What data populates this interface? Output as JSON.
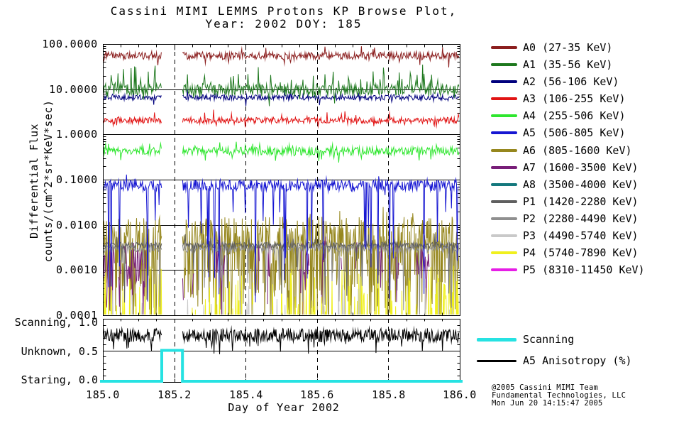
{
  "title": {
    "line1": "Cassini MIMI LEMMS Protons KP Browse Plot,",
    "line2": "Year: 2002 DOY: 185"
  },
  "chart_data": {
    "type": "line",
    "title": "Cassini MIMI LEMMS Protons KP Browse Plot, Year: 2002 DOY: 185",
    "x_axis": {
      "label": "Day of Year 2002",
      "lim": [
        185.0,
        186.0
      ],
      "tick_labels": [
        "185.0",
        "185.2",
        "185.4",
        "185.6",
        "185.8",
        "186.0"
      ],
      "minor_step": 0.05,
      "dashed_gridlines": [
        185.2,
        185.4,
        185.6,
        185.8
      ]
    },
    "y_axis": {
      "label_line1": "Differential Flux",
      "label_line2": "counts/(cm^2*sr*KeV*sec)",
      "scale": "log",
      "log_lim": [
        -4,
        2
      ],
      "tick_labels": [
        "100.0000",
        "10.0000",
        "1.0000",
        "0.1000",
        "0.0100",
        "0.0010",
        "0.0001"
      ]
    },
    "data_gap_x": [
      185.165,
      185.223
    ],
    "series": [
      {
        "name": "A0",
        "label": "A0 (27-35 KeV)",
        "color": "#8b1e1e",
        "visible": true,
        "z": 12,
        "points": 520,
        "typical_flux": 55,
        "log_mean": 1.74,
        "log_jitter": 0.08,
        "spike_up_prob": 0.05,
        "spike_up_max": 0.18,
        "spike_down_prob": 0.05,
        "spike_down_max": 0.22
      },
      {
        "name": "A1",
        "label": "A1 (35-56 KeV)",
        "color": "#1e781e",
        "visible": true,
        "z": 11,
        "points": 520,
        "typical_flux": 10,
        "log_mean": 0.99,
        "log_jitter": 0.13,
        "spike_up_prob": 0.14,
        "spike_up_max": 0.5,
        "spike_down_prob": 0.05,
        "spike_down_max": 0.25
      },
      {
        "name": "A2",
        "label": "A2 (56-106 KeV)",
        "color": "#00007d",
        "visible": true,
        "z": 10,
        "points": 520,
        "typical_flux": 6.6,
        "log_mean": 0.82,
        "log_jitter": 0.06,
        "spike_up_prob": 0.04,
        "spike_up_max": 0.12,
        "spike_down_prob": 0.04,
        "spike_down_max": 0.15
      },
      {
        "name": "A3",
        "label": "A3 (106-255 KeV)",
        "color": "#e11414",
        "visible": true,
        "z": 9,
        "points": 520,
        "typical_flux": 2.0,
        "log_mean": 0.31,
        "log_jitter": 0.07,
        "spike_up_prob": 0.05,
        "spike_up_max": 0.2,
        "spike_down_prob": 0.05,
        "spike_down_max": 0.18
      },
      {
        "name": "A4",
        "label": "A4 (255-506 KeV)",
        "color": "#2ee62e",
        "visible": true,
        "z": 8,
        "points": 520,
        "typical_flux": 0.43,
        "log_mean": -0.37,
        "log_jitter": 0.09,
        "spike_up_prob": 0.06,
        "spike_up_max": 0.2,
        "spike_down_prob": 0.06,
        "spike_down_max": 0.2
      },
      {
        "name": "A5",
        "label": "A5 (506-805 KeV)",
        "color": "#1616d2",
        "visible": true,
        "z": 7,
        "points": 560,
        "typical_flux": 0.074,
        "log_mean": -1.13,
        "log_jitter": 0.12,
        "spike_up_prob": 0.05,
        "spike_up_max": 0.18,
        "spike_down_prob": 0.07,
        "spike_down_max": 2.6
      },
      {
        "name": "A6",
        "label": "A6 (805-1600 KeV)",
        "color": "#96871e",
        "visible": true,
        "z": 1,
        "points": 700,
        "typical_flux": 0.006,
        "log_mean": -2.2,
        "log_jitter": 0.38,
        "spike_up_prob": 0.1,
        "spike_up_max": 0.35,
        "spike_down_prob": 0.5,
        "spike_down_max": 1.9
      },
      {
        "name": "A7",
        "label": "A7 (1600-3500 KeV)",
        "color": "#781e78",
        "visible": true,
        "z": 2,
        "mode": "clustered",
        "points": 560,
        "typical_flux": 0.0016,
        "log_mean": -2.8,
        "log_jitter": 0.45,
        "spike_up_prob": 0.1,
        "spike_up_max": 0.4,
        "spike_down_prob": 0.3,
        "spike_down_max": 1.1
      },
      {
        "name": "A8",
        "label": "A8 (3500-4000 KeV)",
        "color": "#14787d",
        "visible": false,
        "z": 0,
        "typical_flux": null
      },
      {
        "name": "P1",
        "label": "P1 (1420-2280 KeV)",
        "color": "#5f5f5f",
        "visible": true,
        "z": 6,
        "points": 560,
        "typical_flux": 0.0035,
        "log_mean": -2.45,
        "log_jitter": 0.07,
        "spike_up_prob": 0.03,
        "spike_up_max": 0.25,
        "spike_down_prob": 0.04,
        "spike_down_max": 1.5
      },
      {
        "name": "P2",
        "label": "P2 (2280-4490 KeV)",
        "color": "#8f8f8f",
        "visible": true,
        "z": 5,
        "points": 560,
        "typical_flux": 0.003,
        "log_mean": -2.52,
        "log_jitter": 0.09,
        "spike_up_prob": 0.03,
        "spike_up_max": 0.2,
        "spike_down_prob": 0.04,
        "spike_down_max": 1.6
      },
      {
        "name": "P3",
        "label": "P3 (4490-5740 KeV)",
        "color": "#c9c9c9",
        "visible": true,
        "z": 4,
        "mode": "bottom_spikes",
        "points": 620,
        "typical_flux": 0.0002,
        "floor": -4.35,
        "spike_prob": 0.1,
        "spike_top": -3.45
      },
      {
        "name": "P4",
        "label": "P4 (5740-7890 KeV)",
        "color": "#f0f01e",
        "visible": true,
        "z": 3,
        "mode": "bottom_spikes",
        "points": 680,
        "typical_flux": 0.0003,
        "floor": -4.35,
        "spike_prob": 0.38,
        "spike_top": -3.25
      },
      {
        "name": "P5",
        "label": "P5 (8310-11450 KeV)",
        "color": "#e61ee6",
        "visible": false,
        "z": 0,
        "typical_flux": null
      }
    ],
    "status_panel": {
      "tick_labels": [
        "Scanning, 1.0",
        "Unknown, 0.5",
        "Staring, 0.0"
      ],
      "ylim": [
        0,
        1
      ],
      "scanning": {
        "legend_label": "Scanning",
        "color": "#26e2e2",
        "base_value": 0.0,
        "pulse_value": 0.5,
        "pulse_start": 185.165,
        "pulse_end": 185.223
      },
      "anisotropy": {
        "legend_label": "A5 Anisotropy (%)",
        "color": "#000000",
        "mean": 0.74,
        "jitter": 0.11,
        "points": 640
      }
    }
  },
  "credit": {
    "line1": "@2005 Cassini MIMI Team",
    "line2": "Fundamental Technologies, LLC",
    "line3": "Mon Jun 20 14:15:47 2005"
  }
}
